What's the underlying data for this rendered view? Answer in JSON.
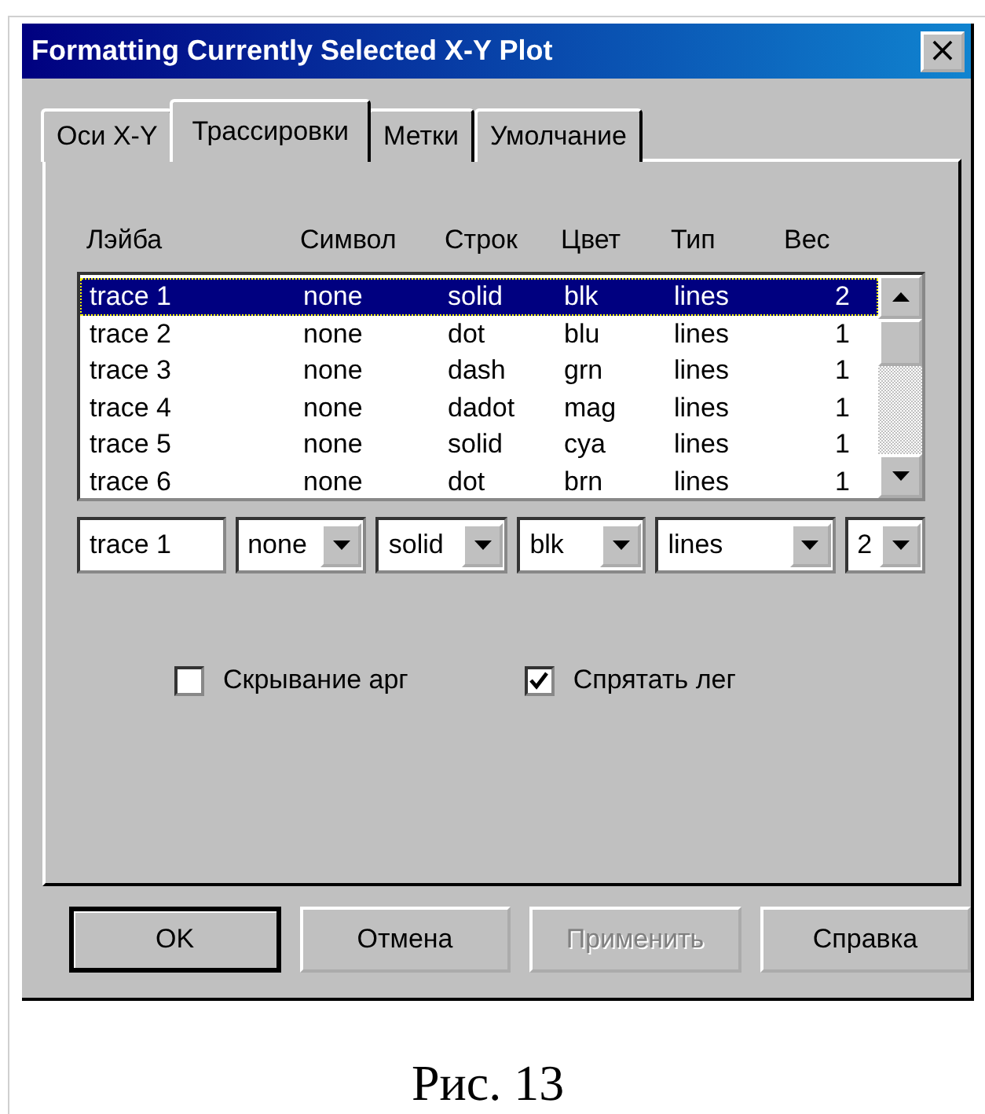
{
  "window": {
    "title": "Formatting Currently Selected X-Y Plot",
    "close": "×"
  },
  "tabs": [
    {
      "label": "Оси X-Y",
      "selected": false
    },
    {
      "label": "Трассировки",
      "selected": true
    },
    {
      "label": "Метки",
      "selected": false
    },
    {
      "label": "Умолчание",
      "selected": false
    }
  ],
  "table": {
    "columns": [
      "Лэйба",
      "Символ",
      "Строк",
      "Цвет",
      "Тип",
      "Вес"
    ],
    "rows": [
      {
        "cells": [
          "trace 1",
          "none",
          "solid",
          "blk",
          "lines",
          "2"
        ],
        "selected": true
      },
      {
        "cells": [
          "trace 2",
          "none",
          "dot",
          "blu",
          "lines",
          "1"
        ],
        "selected": false
      },
      {
        "cells": [
          "trace 3",
          "none",
          "dash",
          "grn",
          "lines",
          "1"
        ],
        "selected": false
      },
      {
        "cells": [
          "trace 4",
          "none",
          "dadot",
          "mag",
          "lines",
          "1"
        ],
        "selected": false
      },
      {
        "cells": [
          "trace 5",
          "none",
          "solid",
          "cya",
          "lines",
          "1"
        ],
        "selected": false
      },
      {
        "cells": [
          "trace 6",
          "none",
          "dot",
          "brn",
          "lines",
          "1"
        ],
        "selected": false
      }
    ]
  },
  "editors": {
    "label_value": "trace 1",
    "dropdowns": [
      "none",
      "solid",
      "blk",
      "lines",
      "2"
    ]
  },
  "checkboxes": [
    {
      "label": "Скрывание арг",
      "checked": false
    },
    {
      "label": "Спрятать лег",
      "checked": true
    }
  ],
  "buttons": [
    {
      "label": "OK",
      "default": true,
      "disabled": false
    },
    {
      "label": "Отмена",
      "default": false,
      "disabled": false
    },
    {
      "label": "Применить",
      "default": false,
      "disabled": true
    },
    {
      "label": "Справка",
      "default": false,
      "disabled": false
    }
  ],
  "caption": "Рис. 13"
}
